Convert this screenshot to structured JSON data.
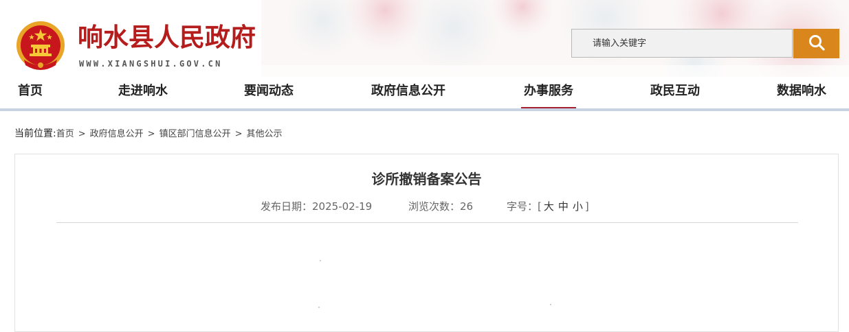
{
  "header": {
    "site_title": "响水县人民政府",
    "site_url": "WWW.XIANGSHUI.GOV.CN",
    "emblem_icon": "national-emblem-icon",
    "search": {
      "placeholder": "请输入关键字",
      "button_icon": "search-icon"
    }
  },
  "nav": {
    "items": [
      {
        "label": "首页"
      },
      {
        "label": "走进响水"
      },
      {
        "label": "要闻动态"
      },
      {
        "label": "政府信息公开"
      },
      {
        "label": "办事服务"
      },
      {
        "label": "政民互动"
      },
      {
        "label": "数据响水"
      }
    ],
    "active_label": "办事服务"
  },
  "breadcrumb": {
    "lead": "当前位置:",
    "items": [
      "首页",
      "政府信息公开",
      "镇区部门信息公开",
      "其他公示"
    ],
    "separator": ">"
  },
  "article": {
    "title": "诊所撤销备案公告",
    "publish_label": "发布日期：",
    "publish_date": "2025-02-19",
    "views_label": "浏览次数：",
    "views": "26",
    "font_label": "字号：",
    "font_open": "[",
    "font_large": "大",
    "font_medium": "中",
    "font_small": "小",
    "font_close": "]"
  },
  "colors": {
    "title_red": "#b51c1c",
    "search_button": "#d9861c",
    "nav_active": "#a52030",
    "nav_line": "#c8d3e3"
  }
}
